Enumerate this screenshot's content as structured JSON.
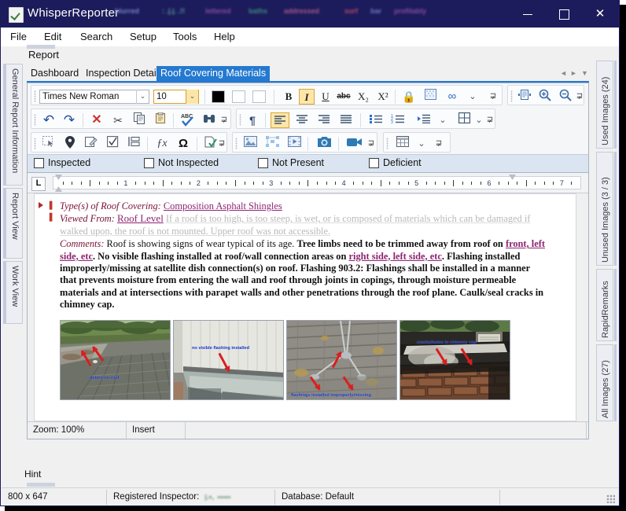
{
  "window": {
    "title": "WhisperReporter",
    "icon": "document-check-icon",
    "controls": {
      "minimize": "–",
      "maximize": "□",
      "close": "✕"
    },
    "accent": "#1c1c5c"
  },
  "menubar": {
    "items": [
      "File",
      "Edit",
      "Search",
      "Setup",
      "Tools",
      "Help"
    ]
  },
  "report": {
    "label": "Report",
    "tabs": [
      {
        "label": "Dashboard",
        "active": false
      },
      {
        "label": "Inspection Details",
        "active": false
      },
      {
        "label": "Roof Covering Materials",
        "active": true
      }
    ],
    "tab_nav": {
      "prev": "◄",
      "next": "►",
      "list": "▼"
    },
    "active_tab_color": "#2479d0"
  },
  "left_tabs": [
    {
      "label": "General Report Information"
    },
    {
      "label": "Report View"
    },
    {
      "label": "Work View"
    }
  ],
  "right_tabs": [
    {
      "label": "Used Images (24)"
    },
    {
      "label": "Unused Images (3 / 3)"
    },
    {
      "label": "RapidRemarks"
    },
    {
      "label": "All Images (27)"
    }
  ],
  "toolbar": {
    "font_name": "Times New Roman",
    "font_size": "10",
    "colors": {
      "text_color": "#000000",
      "highlight_color": "#ffffff",
      "background_color": "#ffffff"
    },
    "row1": [
      {
        "name": "bold-button",
        "glyph": "B",
        "active": false
      },
      {
        "name": "italic-button",
        "glyph": "I",
        "active": true
      },
      {
        "name": "underline-button",
        "glyph": "U",
        "active": false
      },
      {
        "name": "strikethrough-button",
        "glyph": "abc",
        "active": false
      },
      {
        "name": "subscript-button",
        "glyph": "X₂",
        "active": false
      },
      {
        "name": "superscript-button",
        "glyph": "X²",
        "active": false
      },
      {
        "name": "lock-icon",
        "glyph": "🔒",
        "active": false
      },
      {
        "name": "texture-fill-button",
        "glyph": "▨",
        "active": false
      },
      {
        "name": "hyperlink-button",
        "glyph": "∞",
        "active": false
      },
      {
        "name": "overflow-chevron",
        "glyph": "⌄",
        "active": false
      }
    ],
    "row1b": [
      {
        "name": "page-layout-button",
        "glyph": "▤"
      },
      {
        "name": "zoom-in-button",
        "glyph": "⊕"
      },
      {
        "name": "zoom-out-button",
        "glyph": "⊖"
      }
    ],
    "row2": [
      {
        "name": "undo-button",
        "glyph": "↶"
      },
      {
        "name": "redo-button",
        "glyph": "↷"
      },
      {
        "name": "delete-button",
        "glyph": "✕"
      },
      {
        "name": "cut-button",
        "glyph": "✂"
      },
      {
        "name": "copy-button",
        "glyph": "⎘"
      },
      {
        "name": "paste-button",
        "glyph": "📋"
      },
      {
        "name": "spellcheck-button",
        "glyph": "ABC✓"
      },
      {
        "name": "find-button",
        "glyph": "🔍"
      }
    ],
    "row2b": [
      {
        "name": "show-marks-button",
        "glyph": "¶"
      },
      {
        "name": "align-left-button",
        "glyph": "≡",
        "active": true
      },
      {
        "name": "align-center-button",
        "glyph": "≡"
      },
      {
        "name": "align-right-button",
        "glyph": "≡"
      },
      {
        "name": "align-justify-button",
        "glyph": "≡"
      },
      {
        "name": "bullet-list-button",
        "glyph": "•≡"
      },
      {
        "name": "numbered-list-button",
        "glyph": "1≡"
      },
      {
        "name": "indent-button",
        "glyph": "→≡"
      },
      {
        "name": "indent-chevron",
        "glyph": "⌄"
      },
      {
        "name": "table-button",
        "glyph": "⊞"
      },
      {
        "name": "table-chevron",
        "glyph": "⌄"
      }
    ],
    "row3": [
      {
        "name": "select-object-button",
        "glyph": "⬚"
      },
      {
        "name": "map-pin-icon",
        "glyph": "📍"
      },
      {
        "name": "edit-note-button",
        "glyph": "📝"
      },
      {
        "name": "checkbox-insert-button",
        "glyph": "☑"
      },
      {
        "name": "split-view-button",
        "glyph": "⊣"
      },
      {
        "name": "formula-button",
        "glyph": "ƒx"
      },
      {
        "name": "symbol-button",
        "glyph": "Ω"
      },
      {
        "name": "validate-document-button",
        "glyph": "🗋✓"
      }
    ],
    "row3b": [
      {
        "name": "insert-image-button",
        "glyph": "🖼"
      },
      {
        "name": "arrange-objects-button",
        "glyph": "⁘"
      },
      {
        "name": "insert-video-button",
        "glyph": "▶"
      },
      {
        "name": "camera-button",
        "glyph": "📷"
      },
      {
        "name": "camcorder-button",
        "glyph": "🎥"
      },
      {
        "name": "grid-table-button",
        "glyph": "▦"
      },
      {
        "name": "grid-chevron",
        "glyph": "⌄"
      }
    ]
  },
  "condition_checkboxes": [
    {
      "label": "Inspected",
      "checked": false
    },
    {
      "label": "Not Inspected",
      "checked": false
    },
    {
      "label": "Not Present",
      "checked": false
    },
    {
      "label": "Deficient",
      "checked": false
    }
  ],
  "ruler": {
    "tab_stop_glyph": "L",
    "numbers": [
      "1",
      "2",
      "3",
      "4",
      "5",
      "6",
      "7"
    ]
  },
  "document": {
    "line1_label": "Type(s) of Roof Covering:",
    "line1_value": "Composition Asphalt Shingles",
    "line2_label": "Viewed From:",
    "line2_value": "Roof Level",
    "line2_ghost": "If a roof is too high, is too steep, is wet, or is composed of materials which can be  damaged if walked upon, the roof is not mounted. Upper roof was not accessible.",
    "comments_label": "Comments:",
    "comments_plain1": " Roof is showing signs of wear typical of its age. ",
    "comments_bold1": "Tree limbs need to be trimmed away from roof on ",
    "comments_link1": "front, left side, etc",
    "comments_bold2": ". No visible flashing installed at roof/wall connection areas on ",
    "comments_link2": "right side, left side, etc",
    "comments_bold3": ". Flashing installed improperly/missing at satellite dish connection(s) on roof. Flashing 903.2: Flashings shall be installed in a manner that prevents moisture from entering the wall and roof through joints in copings, through moisture permeable materials and at intersections with parapet walls and other penetrations through the roof plane. Caulk/seal cracks in chimney cap."
  },
  "photos": [
    {
      "name": "photo-roof-debris",
      "annotation": "debris on roof"
    },
    {
      "name": "photo-no-flashing",
      "annotation": "no visible flashing installed"
    },
    {
      "name": "photo-satellite-flashing",
      "annotation": "flashings installed improperly/missing"
    },
    {
      "name": "photo-chimney-cap",
      "annotation": "cracks/holes in chimney cap"
    }
  ],
  "editor_footer": {
    "zoom": "Zoom: 100%",
    "insert_mode": "Insert",
    "extra": ""
  },
  "hint": {
    "label": "Hint"
  },
  "statusbar": {
    "dimensions": "800 x 647",
    "inspector_label": "Registered Inspector:",
    "inspector_value": "redacted-name",
    "database": "Database: Default"
  }
}
